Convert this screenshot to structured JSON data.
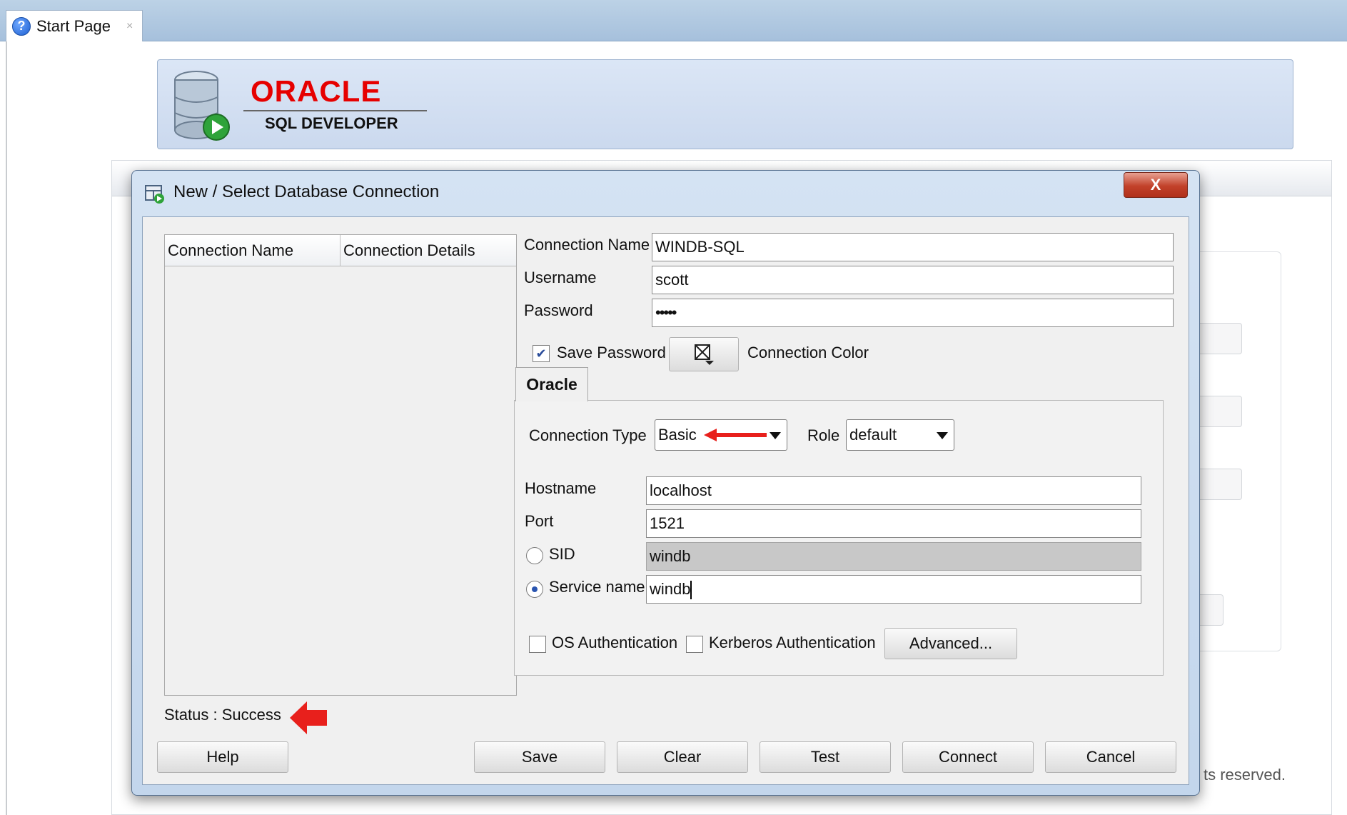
{
  "tab": {
    "label": "Start Page",
    "close": "×",
    "help_glyph": "?"
  },
  "banner": {
    "brand": "ORACLE",
    "product": "SQL DEVELOPER"
  },
  "background": {
    "footer_text": "ts reserved."
  },
  "dialog": {
    "title": "New / Select Database Connection",
    "close_glyph": "X",
    "list": {
      "columns": [
        "Connection Name",
        "Connection Details"
      ],
      "rows": []
    },
    "status": "Status : Success",
    "form": {
      "connection_name_label": "Connection Name",
      "connection_name_value": "WINDB-SQL",
      "username_label": "Username",
      "username_value": "scott",
      "password_label": "Password",
      "password_value": "•••••",
      "save_password_label": "Save Password",
      "save_password_checked": true,
      "connection_color_label": "Connection Color",
      "oracle_tab_label": "Oracle",
      "connection_type_label": "Connection Type",
      "connection_type_value": "Basic",
      "role_label": "Role",
      "role_value": "default",
      "hostname_label": "Hostname",
      "hostname_value": "localhost",
      "port_label": "Port",
      "port_value": "1521",
      "sid_label": "SID",
      "sid_value": "windb",
      "service_name_label": "Service name",
      "service_name_value": "windb",
      "connection_mode": "Service name",
      "os_auth_label": "OS Authentication",
      "kerberos_auth_label": "Kerberos Authentication",
      "advanced_button": "Advanced..."
    },
    "buttons": {
      "help": "Help",
      "save": "Save",
      "clear": "Clear",
      "test": "Test",
      "connect": "Connect",
      "cancel": "Cancel"
    }
  },
  "colors": {
    "accent_red": "#e60000",
    "annotation_arrow": "#e8201c",
    "title_bar": "#c8d9ee"
  }
}
